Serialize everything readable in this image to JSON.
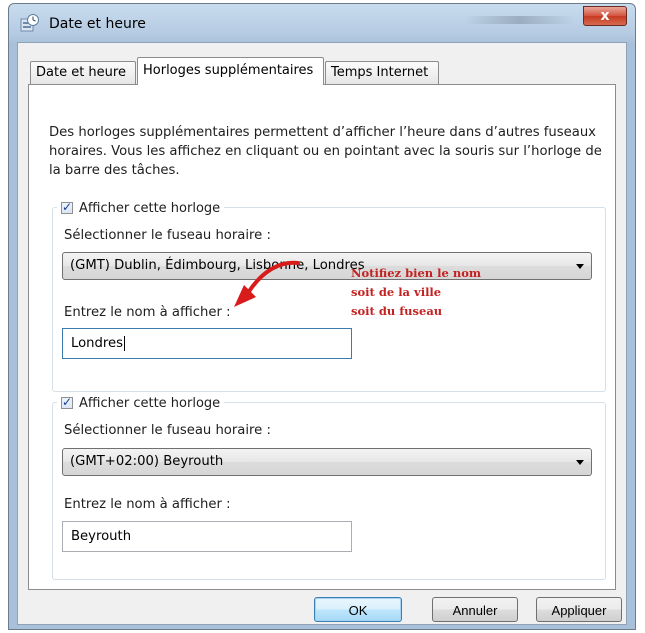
{
  "window": {
    "title": "Date et heure",
    "close_label": "x"
  },
  "tabs": [
    {
      "label": "Date et heure",
      "active": false
    },
    {
      "label": "Horloges supplémentaires",
      "active": true
    },
    {
      "label": "Temps Internet",
      "active": false
    }
  ],
  "intro_text": "Des horloges supplémentaires permettent d’afficher l’heure dans d’autres fuseaux horaires. Vous les affichez en cliquant ou en pointant avec la souris sur l’horloge de la barre des tâches.",
  "clocks": [
    {
      "checkbox_label": "Afficher cette horloge",
      "checked": true,
      "timezone_label": "Sélectionner le fuseau horaire :",
      "timezone_value": "(GMT) Dublin, Édimbourg, Lisbonne, Londres",
      "name_label": "Entrez le nom à afficher :",
      "name_value": "Londres"
    },
    {
      "checkbox_label": "Afficher cette horloge",
      "checked": true,
      "timezone_label": "Sélectionner le fuseau horaire :",
      "timezone_value": "(GMT+02:00) Beyrouth",
      "name_label": "Entrez le nom à afficher :",
      "name_value": "Beyrouth"
    }
  ],
  "annotation": {
    "lines": [
      "Notifiez bien le nom",
      "soit de la ville",
      "soit du fuseau"
    ],
    "color": "#c42121"
  },
  "buttons": {
    "ok": "OK",
    "cancel": "Annuler",
    "apply": "Appliquer"
  }
}
